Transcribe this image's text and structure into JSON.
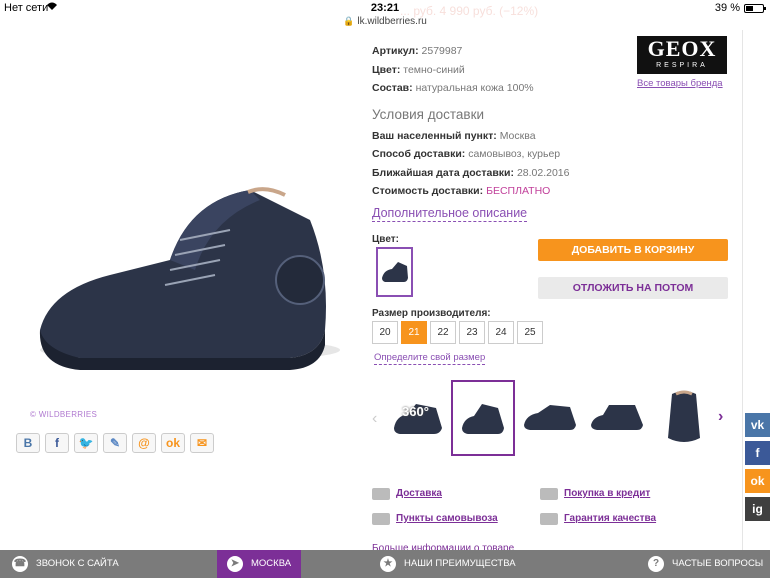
{
  "status": {
    "carrier": "Нет сети",
    "time": "23:21",
    "battery": "39 %"
  },
  "browser": {
    "url": "lk.wildberries.ru"
  },
  "faded_header": {
    "price_text": "... руб. 4 990 руб. (−12%)"
  },
  "product": {
    "article_label": "Артикул:",
    "article_value": "2579987",
    "color_label": "Цвет:",
    "color_value": "темно-синий",
    "composition_label": "Состав:",
    "composition_value": "натуральная кожа 100%",
    "watermark": "© WILDBERRIES"
  },
  "brand": {
    "logo_main": "GEOX",
    "logo_sub": "RESPIRA",
    "all_goods_link": "Все товары бренда"
  },
  "delivery": {
    "title": "Условия доставки",
    "city_label": "Ваш населенный пункт:",
    "city_value": "Москва",
    "method_label": "Способ доставки:",
    "method_value": "самовывоз, курьер",
    "date_label": "Ближайшая дата доставки:",
    "date_value": "28.02.2016",
    "cost_label": "Стоимость доставки:",
    "cost_value": "БЕСПЛАТНО"
  },
  "extra_description_link": "Дополнительное описание",
  "color_picker_label": "Цвет:",
  "buttons": {
    "add_to_cart": "ДОБАВИТЬ В КОРЗИНУ",
    "save_for_later": "ОТЛОЖИТЬ НА ПОТОМ"
  },
  "sizes": {
    "label": "Размер производителя:",
    "options": [
      "20",
      "21",
      "22",
      "23",
      "24",
      "25"
    ],
    "selected": "21",
    "find_size_link": "Определите свой размер"
  },
  "gallery": {
    "badge_360": "360°"
  },
  "features": [
    {
      "label": "Доставка"
    },
    {
      "label": "Покупка в кредит"
    },
    {
      "label": "Пункты самовывоза"
    },
    {
      "label": "Гарантия качества"
    }
  ],
  "more_info_link": "Больше информации о товаре",
  "social": {
    "vk": "vk",
    "facebook": "f",
    "odnoklassniki": "ok",
    "instagram": "ig"
  },
  "bottom_bar": {
    "call": "ЗВОНОК С САЙТА",
    "city": "МОСКВА",
    "advantages": "НАШИ ПРЕИМУЩЕСТВА",
    "faq": "ЧАСТЫЕ ВОПРОСЫ"
  },
  "colors": {
    "accent_orange": "#f7941d",
    "accent_purple": "#7c2f97",
    "free_pink": "#c13f9a"
  }
}
